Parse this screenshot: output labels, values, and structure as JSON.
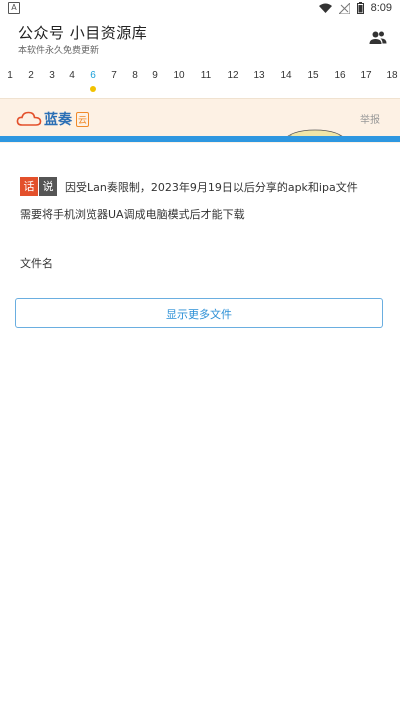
{
  "statusbar": {
    "time": "8:09",
    "left_icon_label": "A"
  },
  "appbar": {
    "title": "公众号 小目资源库",
    "subtitle": "本软件永久免费更新"
  },
  "tabs": [
    "1",
    "2",
    "3",
    "4",
    "6",
    "7",
    "8",
    "9",
    "10",
    "11",
    "12",
    "13",
    "14",
    "15",
    "16",
    "17",
    "18"
  ],
  "active_tab": "6",
  "banner": {
    "logo_text": "蓝奏",
    "logo_badge": "云",
    "report": "举报"
  },
  "notice": {
    "badge_a": "话",
    "badge_b": "说",
    "line1": "因受Lan奏限制，2023年9月19日以后分享的apk和ipa文件",
    "line2": "需要将手机浏览器UA调成电脑模式后才能下载"
  },
  "file_list": {
    "header": "文件名"
  },
  "more_button": "显示更多文件",
  "colors": {
    "accent": "#1a9fd8",
    "badge_orange": "#e3502b",
    "banner_bg": "#fdf1e4",
    "button_border": "#6aaee0"
  }
}
